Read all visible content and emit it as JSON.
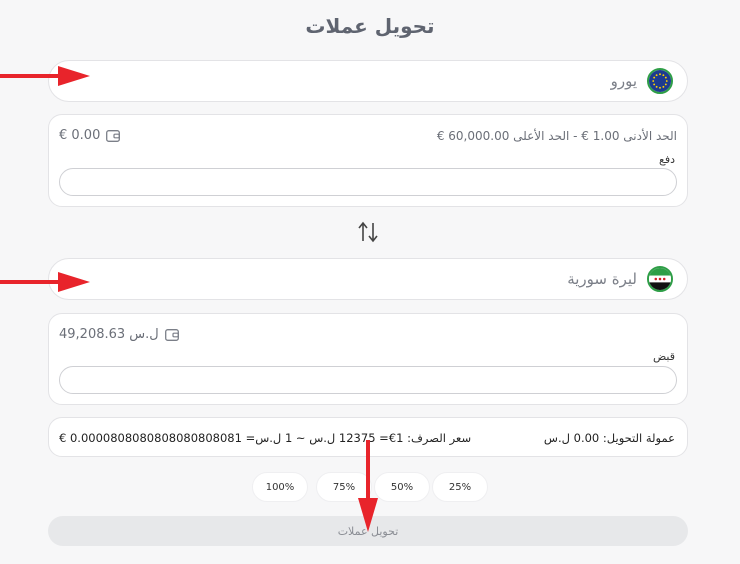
{
  "page_title": "تحويل عملات",
  "from": {
    "currency_label": "يورو",
    "flag_icon": "eu-flag-icon",
    "limits_text": "الحد الأدنى 1.00 €   -   الحد الأعلى 60,000.00 €",
    "balance": "€ 0.00",
    "field_label": "دفع",
    "amount_value": ""
  },
  "to": {
    "currency_label": "ليرة سورية",
    "flag_icon": "syria-flag-icon",
    "balance": "49,208.63 ل.س",
    "field_label": "قبض",
    "amount_value": ""
  },
  "info": {
    "fee": "عمولة التحويل: 0.00 ل.س",
    "rate": "سعر الصرف: 1€= 12375 ل.س ~ 1 ل.س= 0.0000808080808080808081 €"
  },
  "percent_buttons": [
    "100%",
    "75%",
    "50%",
    "25%"
  ],
  "submit_label": "تحويل عملات",
  "colors": {
    "accent_green": "#2e9e47",
    "annotation_red": "#e8242b"
  }
}
